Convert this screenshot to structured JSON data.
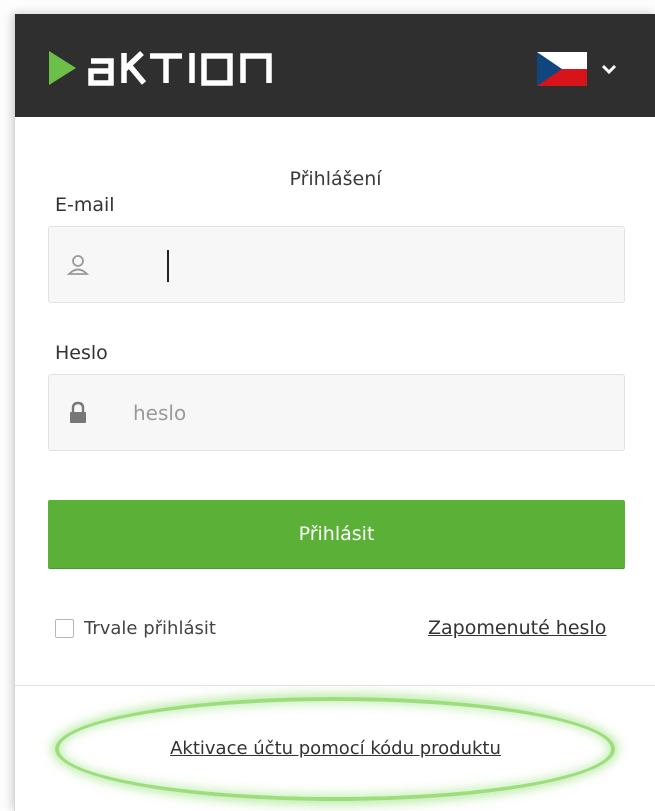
{
  "header": {
    "brand": "AKTION",
    "language_icon": "czech-flag-icon",
    "dropdown_icon": "chevron-down-icon",
    "colors": {
      "background": "#2f2f2f",
      "logo_green": "#6cc04a"
    }
  },
  "form": {
    "title": "Přihlášení",
    "email_label": "E-mail",
    "email_value": "",
    "email_icon": "user-icon",
    "password_label": "Heslo",
    "password_placeholder": "heslo",
    "password_icon": "lock-icon",
    "login_button": "Přihlásit",
    "login_button_color": "#5bb138",
    "remember_label": "Trvale přihlásit",
    "remember_checked": false,
    "forgot_link": "Zapomenuté heslo"
  },
  "footer": {
    "activate_link": "Aktivace účtu pomocí kódu produktu"
  }
}
